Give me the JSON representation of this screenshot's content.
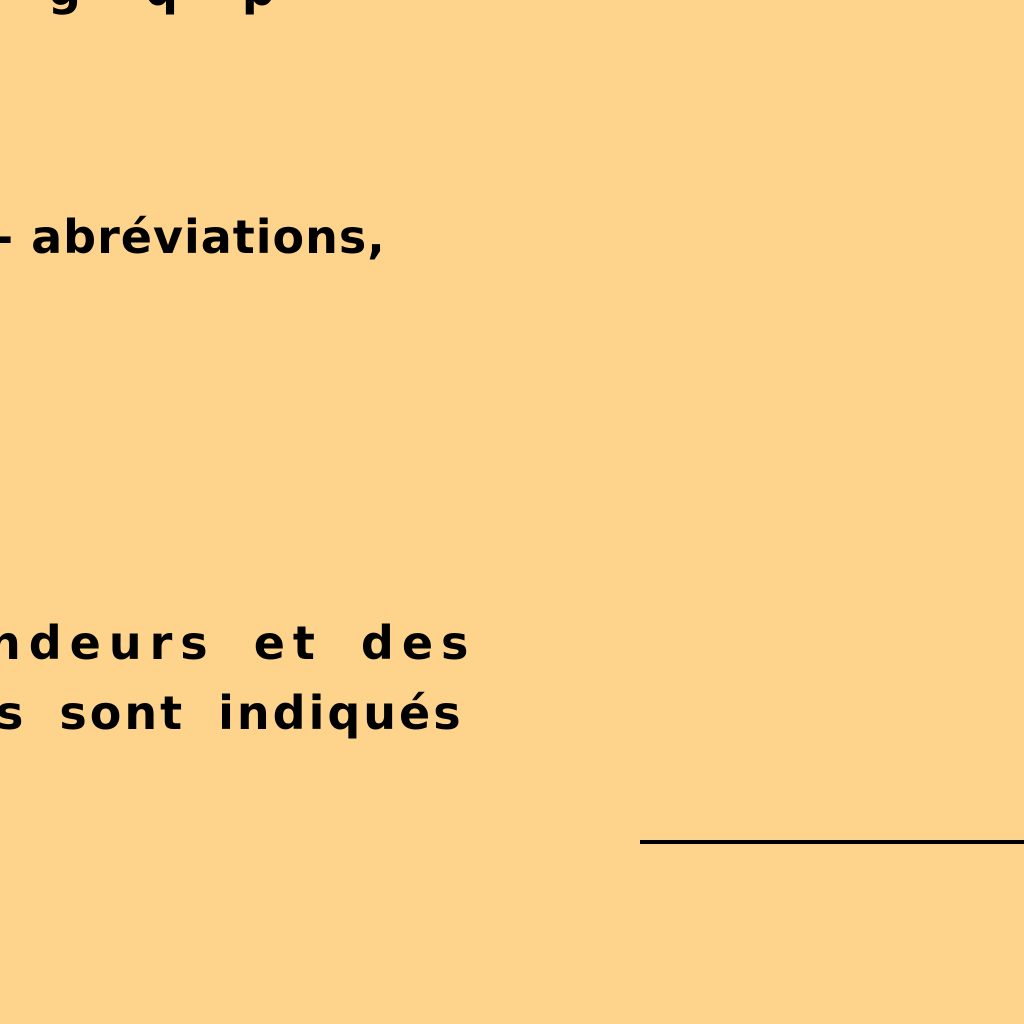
{
  "background_color": "#FED48C",
  "text_color": "#000000",
  "document": {
    "top_fragment": "g q p",
    "lines": [
      "- abréviations,",
      "ndeurs et des",
      "s sont indiqués"
    ]
  }
}
